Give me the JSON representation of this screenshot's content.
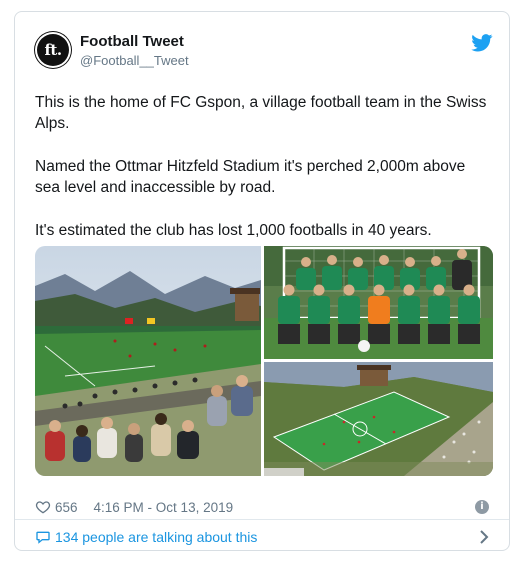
{
  "tweet": {
    "author_name": "Football Tweet",
    "author_handle": "@Football__Tweet",
    "avatar_text": "ft.",
    "paragraphs": [
      "This is the home of FC Gspon, a village football team in the Swiss Alps.",
      "Named the Ottmar Hitzfeld Stadium it's perched 2,000m above sea level and inaccessible by road.",
      "It's estimated the club has lost 1,000 footballs in 40 years."
    ],
    "likes": "656",
    "timestamp": "4:16 PM - Oct 13, 2019",
    "conversation_label": "134 people are talking about this"
  },
  "icons": {
    "brand": "twitter-bird-icon",
    "like": "heart-icon",
    "info": "info-icon",
    "conversation": "speech-bubble-icon",
    "next": "chevron-right-icon"
  },
  "colors": {
    "link": "#1b95e0",
    "muted": "#657786",
    "twitter_blue": "#1da1f2",
    "border": "#d8dee3"
  }
}
